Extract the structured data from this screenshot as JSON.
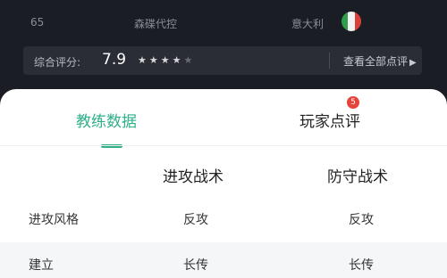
{
  "info": {
    "number": "65",
    "team": "森碟代控",
    "country": "意大利"
  },
  "rating": {
    "label": "综合评分:",
    "score": "7.9",
    "stars_filled": "★★★★",
    "stars_empty": "★",
    "stars_value": 3.5,
    "view_all": "查看全部点评",
    "view_all_arrow": "▶"
  },
  "tabs": {
    "coach": "教练数据",
    "player": "玩家点评",
    "player_badge": "5",
    "active": "coach"
  },
  "table": {
    "columns": [
      "进攻战术",
      "防守战术"
    ],
    "rows": [
      {
        "label": "进攻风格",
        "attack": "反攻",
        "defense": "反攻"
      },
      {
        "label": "建立",
        "attack": "长传",
        "defense": "长传"
      }
    ]
  },
  "colors": {
    "accent": "#2fae88",
    "badge": "#e8433a",
    "dark_bg": "#1b1d24"
  }
}
